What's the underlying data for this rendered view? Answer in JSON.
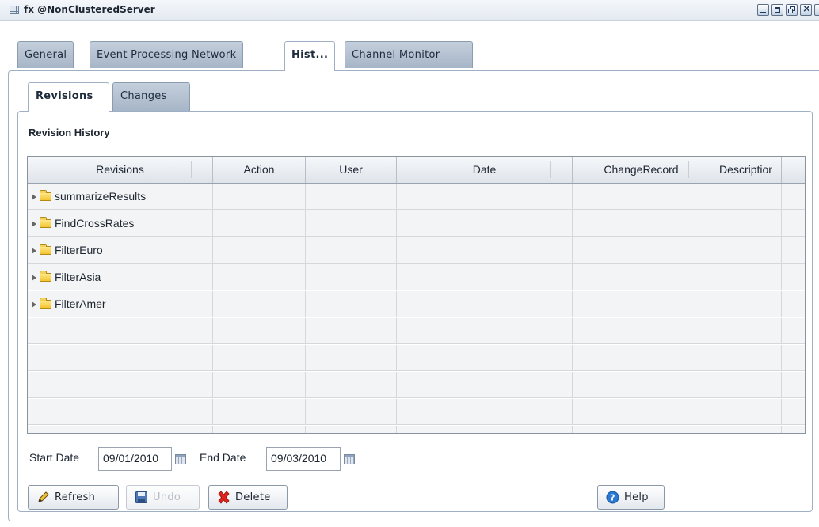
{
  "window": {
    "title": "fx @NonClusteredServer",
    "controls": [
      "minimize-icon",
      "maximize-icon",
      "restore-icon",
      "close-icon"
    ]
  },
  "tabs": [
    {
      "label": "General",
      "active": false
    },
    {
      "label": "Event Processing Network",
      "active": false
    },
    {
      "label": "Hist...",
      "active": true
    },
    {
      "label": "Channel Monitor",
      "active": false
    }
  ],
  "subtabs": [
    {
      "label": "Revisions",
      "active": true
    },
    {
      "label": "Changes",
      "active": false
    }
  ],
  "section": {
    "title": "Revision History"
  },
  "table": {
    "columns": [
      "Revisions",
      "Action",
      "User",
      "Date",
      "ChangeRecord",
      "Descriptior"
    ],
    "rows": [
      {
        "revision": "summarizeResults"
      },
      {
        "revision": "FindCrossRates"
      },
      {
        "revision": "FilterEuro"
      },
      {
        "revision": "FilterAsia"
      },
      {
        "revision": "FilterAmer"
      }
    ]
  },
  "dates": {
    "start_label": "Start Date",
    "start_value": "09/01/2010",
    "end_label": "End Date",
    "end_value": "09/03/2010"
  },
  "buttons": {
    "refresh": "Refresh",
    "undo": "Undo",
    "delete": "Delete",
    "help": "Help"
  },
  "colors": {
    "tab_inactive": "#a6b5c7",
    "panel_border": "#9fb0c4",
    "row_bg": "#f3f4f5",
    "delete_icon": "#e0241b",
    "help_icon": "#2a78d6"
  }
}
